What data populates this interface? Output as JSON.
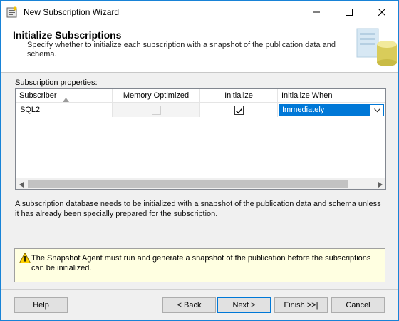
{
  "window": {
    "title": "New Subscription Wizard"
  },
  "header": {
    "title": "Initialize Subscriptions",
    "description": "Specify whether to initialize each subscription with a snapshot of the publication data and schema."
  },
  "grid": {
    "label": "Subscription properties:",
    "columns": [
      "Subscriber",
      "Memory Optimized",
      "Initialize",
      "Initialize When"
    ],
    "sort_column": "Subscriber",
    "rows": [
      {
        "subscriber": "SQL2",
        "memory_optimized": false,
        "memory_optimized_enabled": false,
        "initialize": true,
        "initialize_when": "Immediately"
      }
    ]
  },
  "info": {
    "text": "A subscription database needs to be initialized with a snapshot of the publication data and schema unless it has already been specially prepared for the subscription."
  },
  "warning": {
    "icon": "warning-icon",
    "text": "The Snapshot Agent must run and generate a snapshot of the publication before the subscriptions can be initialized."
  },
  "buttons": {
    "help": "Help",
    "back": "< Back",
    "next": "Next >",
    "finish": "Finish >>|",
    "cancel": "Cancel"
  },
  "colors": {
    "accent": "#0078d7",
    "warning_bg": "#ffffe1",
    "window_border": "#1883d7"
  }
}
